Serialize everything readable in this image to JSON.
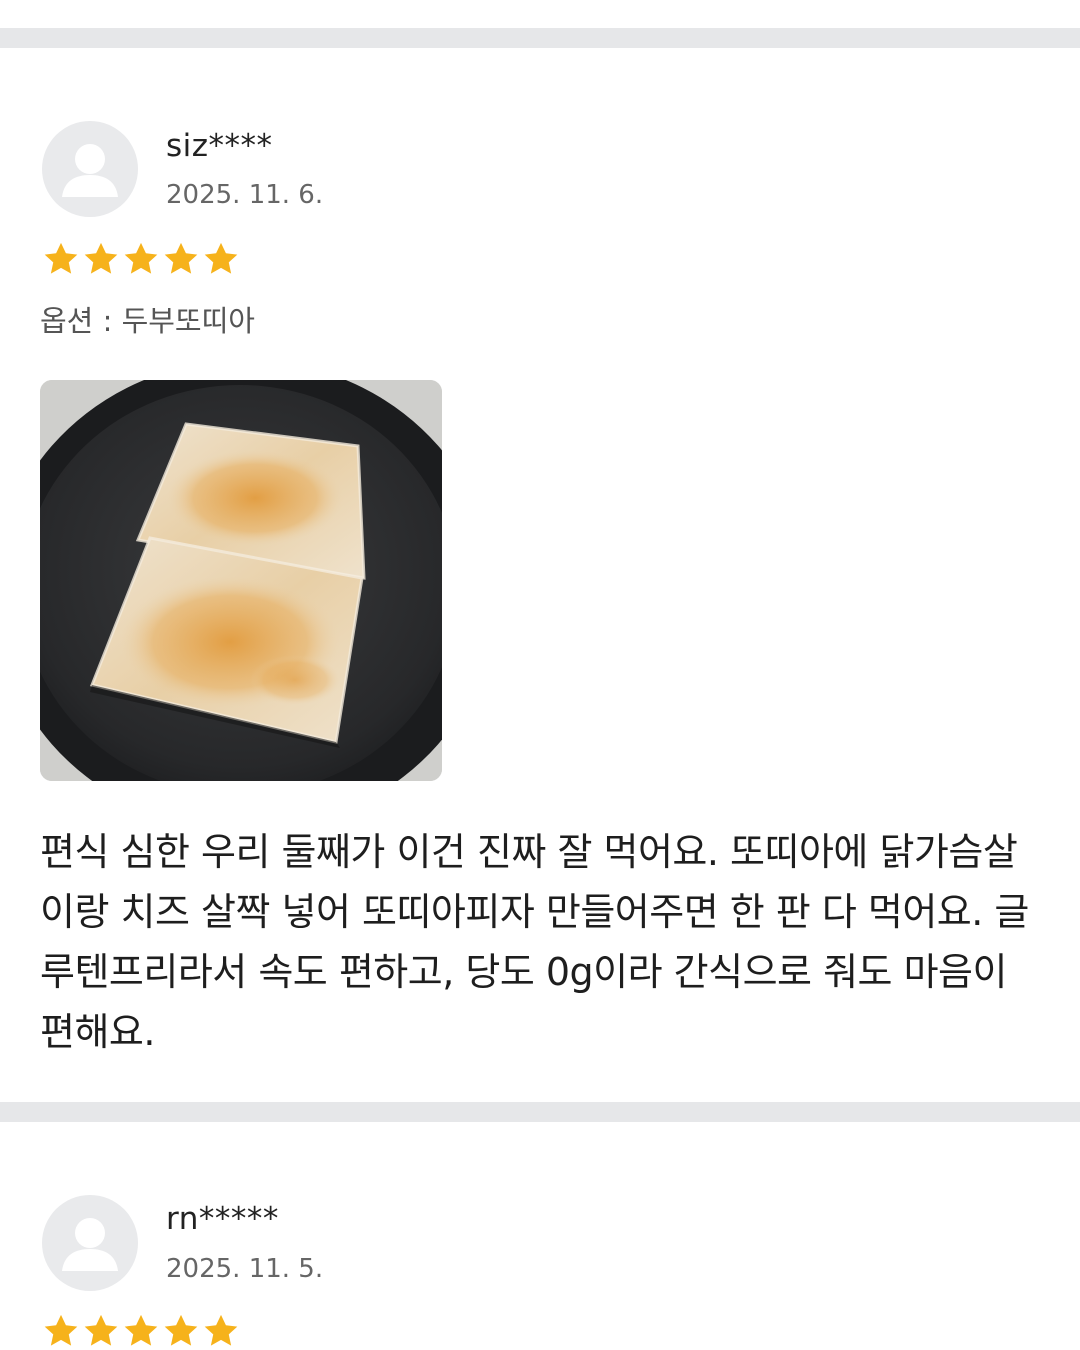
{
  "reviews": [
    {
      "username": "siz****",
      "date": "2025. 11. 6.",
      "rating": 5,
      "rating_max": 5,
      "option": "옵션 : 두부또띠아",
      "has_photo": true,
      "text": "편식 심한 우리 둘째가 이건 진짜 잘 먹어요. 또띠아에 닭가슴살이랑 치즈 살짝 넣어 또띠아피자 만들어주면 한 판 다 먹어요. 글루텐프리라서 속도 편하고, 당도 0g이라 간식으로 줘도 마음이 편해요."
    },
    {
      "username": "rn*****",
      "date": "2025. 11. 5.",
      "rating": 5,
      "rating_max": 5
    }
  ],
  "colors": {
    "star": "#f6b21b",
    "divider": "#e6e7e9",
    "avatar_bg": "#e9eaec",
    "avatar_fg": "#ffffff"
  },
  "icons": {
    "avatar": "user-silhouette-icon",
    "star": "star-icon"
  }
}
